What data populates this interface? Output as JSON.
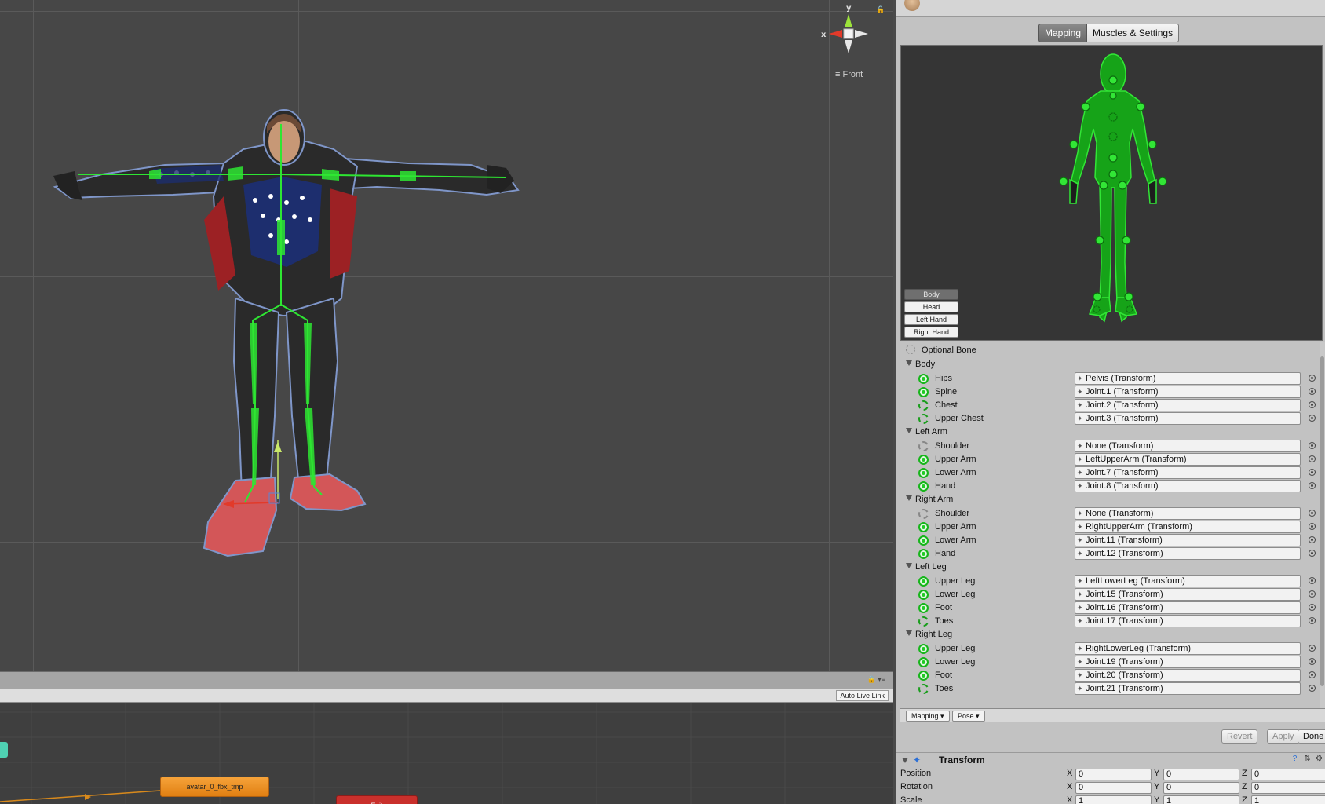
{
  "scene": {
    "view_label": "Front",
    "gizmo": {
      "x_label": "x",
      "y_label": "y"
    }
  },
  "animator": {
    "auto_live_link": "Auto Live Link",
    "states": {
      "avatar": "avatar_0_fbx_tmp",
      "exit": "Exit"
    }
  },
  "inspector": {
    "tabs": [
      "Mapping",
      "Muscles & Settings"
    ],
    "active_tab": "Mapping",
    "body_parts": [
      "Body",
      "Head",
      "Left Hand",
      "Right Hand"
    ],
    "active_part": "Body",
    "optional_bone": "Optional Bone",
    "sections": [
      {
        "title": "Body",
        "bones": [
          {
            "label": "Hips",
            "value": "Pelvis (Transform)",
            "state": "solid"
          },
          {
            "label": "Spine",
            "value": "Joint.1 (Transform)",
            "state": "solid"
          },
          {
            "label": "Chest",
            "value": "Joint.2 (Transform)",
            "state": "dashed"
          },
          {
            "label": "Upper Chest",
            "value": "Joint.3 (Transform)",
            "state": "dashed"
          }
        ]
      },
      {
        "title": "Left Arm",
        "bones": [
          {
            "label": "Shoulder",
            "value": "None (Transform)",
            "state": "empty"
          },
          {
            "label": "Upper Arm",
            "value": "LeftUpperArm (Transform)",
            "state": "solid"
          },
          {
            "label": "Lower Arm",
            "value": "Joint.7 (Transform)",
            "state": "solid"
          },
          {
            "label": "Hand",
            "value": "Joint.8 (Transform)",
            "state": "solid"
          }
        ]
      },
      {
        "title": "Right Arm",
        "bones": [
          {
            "label": "Shoulder",
            "value": "None (Transform)",
            "state": "empty"
          },
          {
            "label": "Upper Arm",
            "value": "RightUpperArm (Transform)",
            "state": "solid"
          },
          {
            "label": "Lower Arm",
            "value": "Joint.11 (Transform)",
            "state": "solid"
          },
          {
            "label": "Hand",
            "value": "Joint.12 (Transform)",
            "state": "solid"
          }
        ]
      },
      {
        "title": "Left Leg",
        "bones": [
          {
            "label": "Upper Leg",
            "value": "LeftLowerLeg (Transform)",
            "state": "solid"
          },
          {
            "label": "Lower Leg",
            "value": "Joint.15 (Transform)",
            "state": "solid"
          },
          {
            "label": "Foot",
            "value": "Joint.16 (Transform)",
            "state": "solid"
          },
          {
            "label": "Toes",
            "value": "Joint.17 (Transform)",
            "state": "dashed"
          }
        ]
      },
      {
        "title": "Right Leg",
        "bones": [
          {
            "label": "Upper Leg",
            "value": "RightLowerLeg (Transform)",
            "state": "solid"
          },
          {
            "label": "Lower Leg",
            "value": "Joint.19 (Transform)",
            "state": "solid"
          },
          {
            "label": "Foot",
            "value": "Joint.20 (Transform)",
            "state": "solid"
          },
          {
            "label": "Toes",
            "value": "Joint.21 (Transform)",
            "state": "dashed"
          }
        ]
      }
    ],
    "bottom_dropdowns": {
      "mapping": "Mapping",
      "pose": "Pose"
    },
    "actions": {
      "revert": "Revert",
      "apply": "Apply",
      "done": "Done"
    },
    "transform": {
      "title": "Transform",
      "rows": [
        {
          "label": "Position",
          "x": "0",
          "y": "0",
          "z": "0"
        },
        {
          "label": "Rotation",
          "x": "0",
          "y": "0",
          "z": "0"
        },
        {
          "label": "Scale",
          "x": "1",
          "y": "1",
          "z": "1"
        }
      ],
      "axes": {
        "x": "X",
        "y": "Y",
        "z": "Z"
      }
    }
  },
  "colors": {
    "bone_green": "#1fcc24",
    "scene_bg": "#474747",
    "state_orange": "#f6a33a",
    "state_red": "#c9302c"
  }
}
